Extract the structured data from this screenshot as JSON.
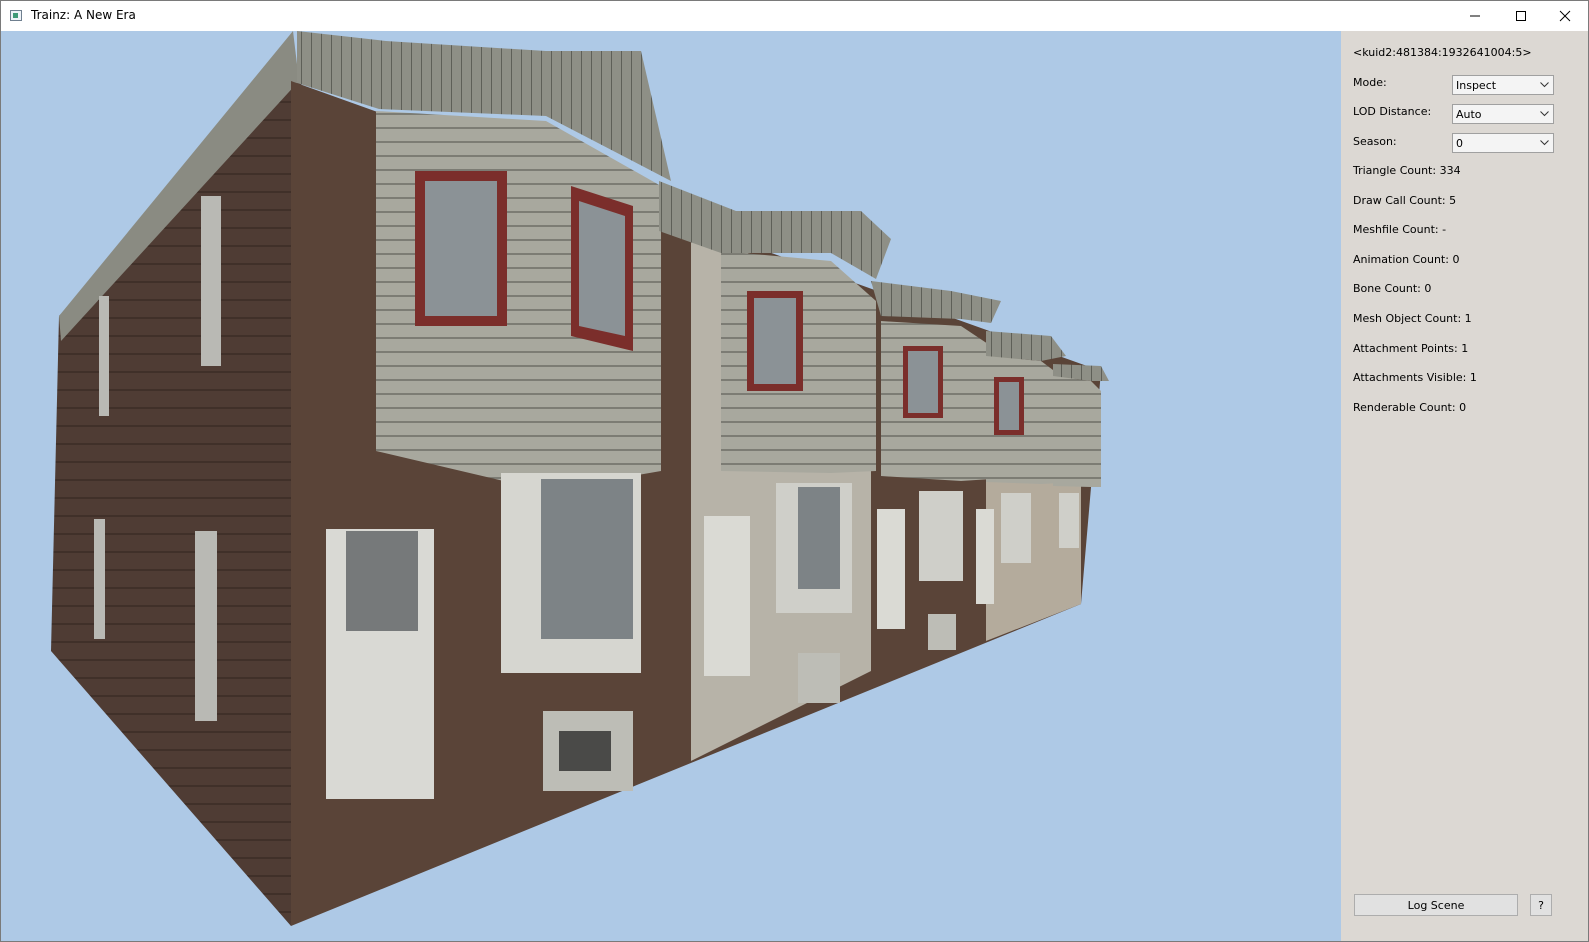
{
  "window": {
    "title": "Trainz: A New Era"
  },
  "viewport": {
    "background_color": "#aec9e6",
    "content": "3D building preview"
  },
  "panel": {
    "kuid": "<kuid2:481384:1932641004:5>",
    "mode": {
      "label": "Mode:",
      "value": "Inspect"
    },
    "lod": {
      "label": "LOD Distance:",
      "value": "Auto"
    },
    "season": {
      "label": "Season:",
      "value": "0"
    },
    "stats": [
      "Triangle Count: 334",
      "Draw Call Count: 5",
      "Meshfile Count: -",
      "Animation Count: 0",
      "Bone Count: 0",
      "Mesh Object Count: 1",
      "Attachment Points: 1",
      "Attachments Visible: 1",
      "Renderable Count: 0"
    ],
    "log_scene_label": "Log Scene",
    "help_label": "?"
  }
}
